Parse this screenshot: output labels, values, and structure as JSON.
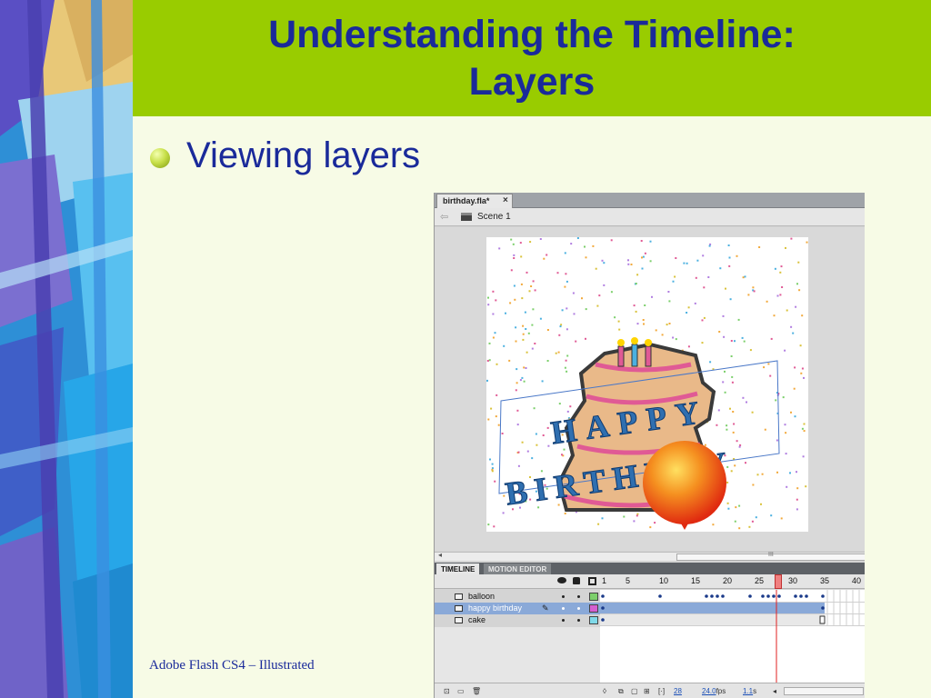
{
  "slide": {
    "title_line1": "Understanding the Timeline:",
    "title_line2": "Layers",
    "bullet": "Viewing layers",
    "footer": "Adobe Flash CS4 – Illustrated"
  },
  "flash": {
    "doc_tab": "birthday.fla*",
    "doc_tab_close": "×",
    "scene": "Scene 1",
    "stage_text_line1": "HAPPY",
    "stage_text_line2": "BIRTHDAY",
    "scroll_grip": "III",
    "timeline": {
      "tabs": [
        "TIMELINE",
        "MOTION EDITOR"
      ],
      "frame_numbers": [
        "1",
        "5",
        "10",
        "15",
        "20",
        "25",
        "30",
        "35",
        "40"
      ],
      "layers": [
        {
          "name": "balloon",
          "color": "#7ccf6b"
        },
        {
          "name": "happy birthday",
          "color": "#d45fd0"
        },
        {
          "name": "cake",
          "color": "#7fd9e8"
        }
      ],
      "current_frame": "28",
      "fps": "24.0",
      "fps_unit": "fps",
      "elapsed": "1.1",
      "elapsed_unit": "s"
    }
  }
}
